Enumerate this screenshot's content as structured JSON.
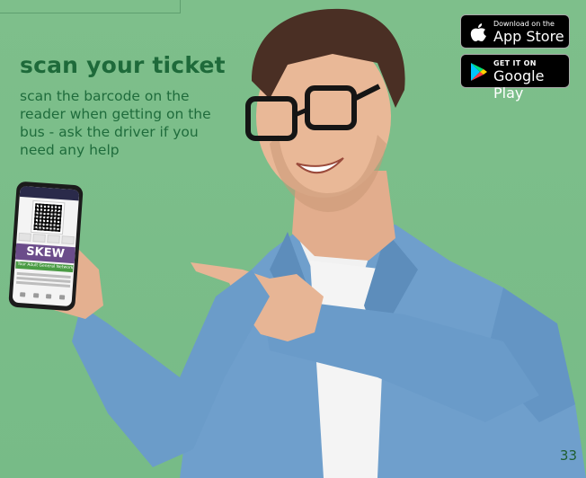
{
  "headline": "scan your ticket",
  "body_text": "scan the barcode on the reader when getting on the bus - ask the driver if you need any help",
  "app_store": {
    "small": "Download on the",
    "big": "App Store"
  },
  "google_play": {
    "small": "GET IT ON",
    "big": "Google Play"
  },
  "phone": {
    "brand_text": "SKEW",
    "ticket_label": "Tour Adult General Network"
  },
  "page_number": "33"
}
